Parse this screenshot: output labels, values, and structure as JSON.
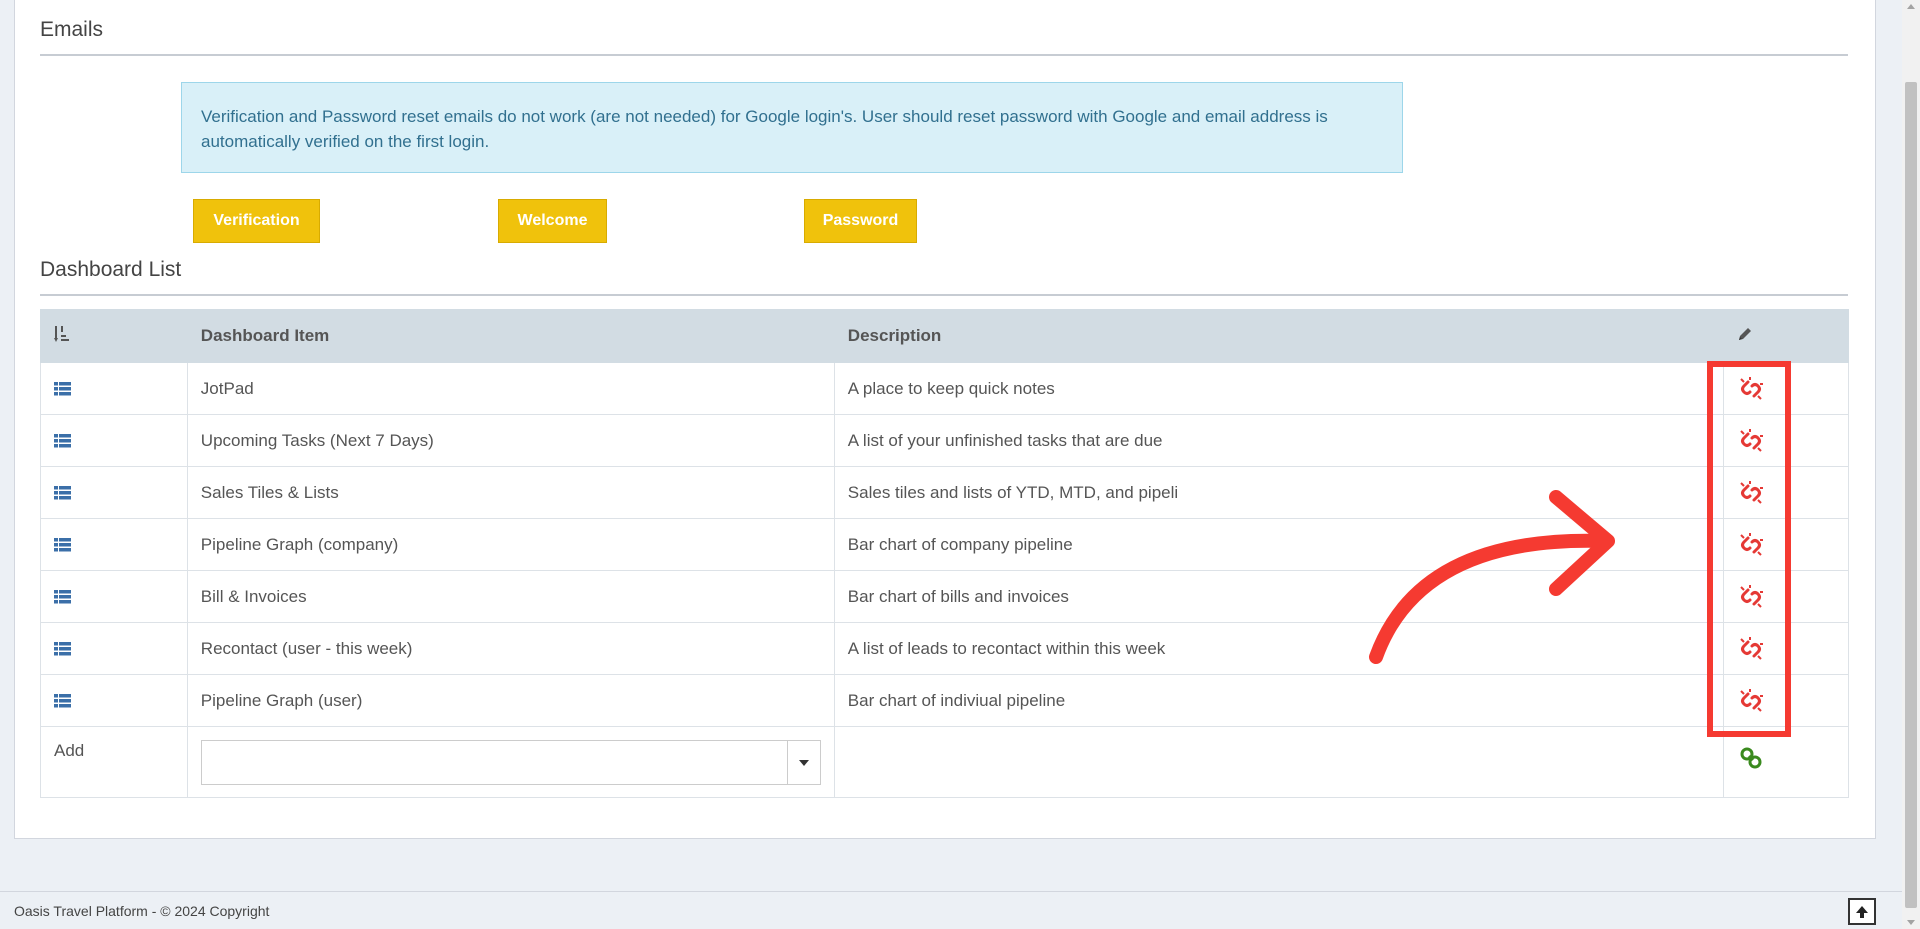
{
  "emails": {
    "title": "Emails",
    "notice": "Verification and Password reset emails do not work (are not needed) for Google login's. User should reset password with Google and email address is automatically verified on the first login.",
    "buttons": [
      "Verification",
      "Welcome",
      "Password"
    ]
  },
  "dashboard": {
    "title": "Dashboard List",
    "headers": {
      "item": "Dashboard Item",
      "description": "Description"
    },
    "rows": [
      {
        "item": "JotPad",
        "description": "A place to keep quick notes"
      },
      {
        "item": "Upcoming Tasks (Next 7 Days)",
        "description": "A list of your unfinished tasks that are due"
      },
      {
        "item": "Sales Tiles & Lists",
        "description": "Sales tiles and lists of YTD, MTD, and pipeli"
      },
      {
        "item": "Pipeline Graph (company)",
        "description": "Bar chart of company pipeline"
      },
      {
        "item": "Bill & Invoices",
        "description": "Bar chart of bills and invoices"
      },
      {
        "item": "Recontact (user - this week)",
        "description": "A list of leads to recontact within this week"
      },
      {
        "item": "Pipeline Graph (user)",
        "description": "Bar chart of indiviual pipeline"
      }
    ],
    "add_label": "Add",
    "add_select_value": ""
  },
  "footer": {
    "text": "Oasis Travel Platform - © 2024 Copyright"
  },
  "colors": {
    "button_yellow": "#f0c20c",
    "unlink_red": "#e53935",
    "link_green": "#3a8a1e",
    "annotation_red": "#f53a31"
  },
  "icons": {
    "sort": "sort-numeric-icon",
    "edit": "pencil-icon",
    "row": "list-icon",
    "remove": "unlink-icon",
    "add": "link-icon",
    "scroll_top": "arrow-up-icon"
  }
}
